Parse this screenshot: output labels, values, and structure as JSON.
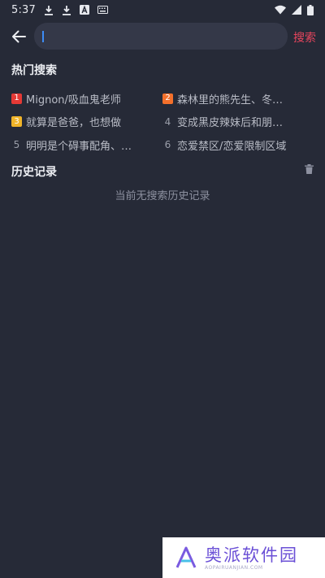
{
  "status_bar": {
    "time": "5:37",
    "icons": [
      "download-icon",
      "download-icon",
      "a-notification-icon",
      "keyboard-icon",
      "wifi-icon",
      "cellular-signal-icon",
      "battery-icon"
    ]
  },
  "search": {
    "value": "",
    "button_label": "搜索"
  },
  "hot_search": {
    "title": "热门搜索",
    "items": [
      {
        "rank": "1",
        "label": "Mignon/吸血鬼老师",
        "badge_color": "#e53935"
      },
      {
        "rank": "2",
        "label": "森林里的熊先生、冬…",
        "badge_color": "#f4702b"
      },
      {
        "rank": "3",
        "label": "就算是爸爸，也想做",
        "badge_color": "#f0b429"
      },
      {
        "rank": "4",
        "label": "变成黑皮辣妹后和朋…",
        "badge_color": ""
      },
      {
        "rank": "5",
        "label": "明明是个碍事配角、…",
        "badge_color": ""
      },
      {
        "rank": "6",
        "label": "恋爱禁区/恋爱限制区域",
        "badge_color": ""
      }
    ]
  },
  "history": {
    "title": "历史记录",
    "empty_text": "当前无搜索历史记录"
  },
  "watermark": {
    "main": "奥派软件园",
    "sub": "AOPAIRUANJIAN.COM"
  },
  "colors": {
    "background": "#262a37",
    "search_field": "#343848",
    "accent": "#e8455d",
    "caret": "#3d8cf5"
  }
}
